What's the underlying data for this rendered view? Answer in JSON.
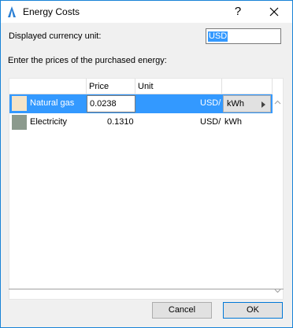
{
  "window": {
    "title": "Energy Costs",
    "help_glyph": "?",
    "accent_color": "#1883d7"
  },
  "currency": {
    "label": "Displayed currency unit:",
    "value": "USD"
  },
  "prices_label": "Enter the prices of the purchased energy:",
  "table": {
    "columns": [
      "",
      "Price",
      "Unit",
      ""
    ],
    "rows": [
      {
        "name": "Natural gas",
        "price": "0.0238",
        "currency_unit": "USD/",
        "energy_unit": "kWh",
        "color": "#f5e4c8",
        "selected": true
      },
      {
        "name": "Electricity",
        "price": "0.1310",
        "currency_unit": "USD/",
        "energy_unit": "kWh",
        "color": "#8b9a8d",
        "selected": false
      }
    ]
  },
  "buttons": {
    "cancel": "Cancel",
    "ok": "OK"
  },
  "icons": {
    "app": "app-triangle-icon",
    "close": "close-icon",
    "dropdown": "dropdown-arrow-icon"
  }
}
